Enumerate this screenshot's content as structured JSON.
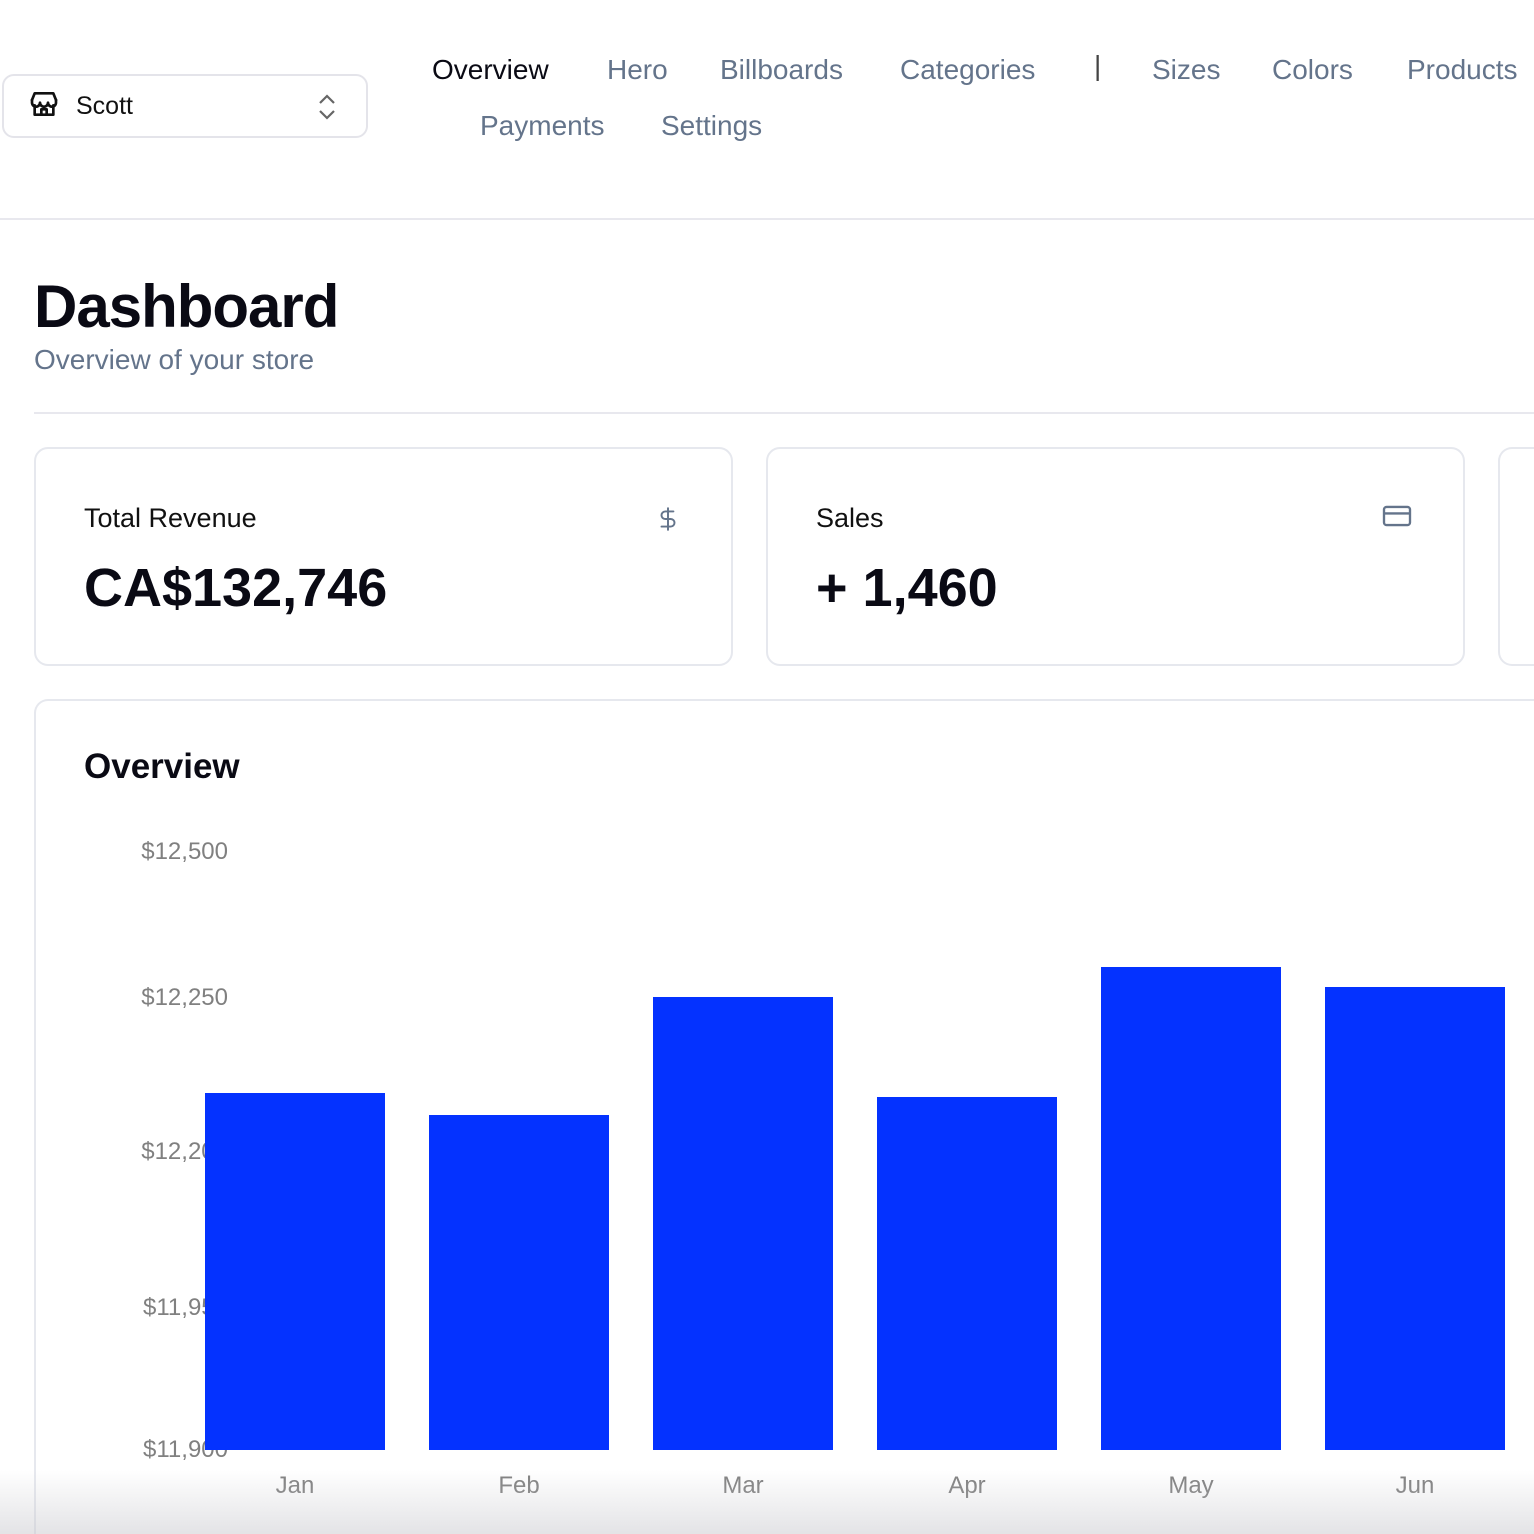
{
  "store_switcher": {
    "name": "Scott",
    "icon": "store-icon",
    "chevron": "chevrons-up-down-icon"
  },
  "nav": {
    "items": [
      "Overview",
      "Hero",
      "Billboards",
      "Categories",
      "|",
      "Sizes",
      "Colors",
      "Products",
      "Payments",
      "Settings"
    ],
    "active": "Overview"
  },
  "header": {
    "title": "Dashboard",
    "subtitle": "Overview of your store"
  },
  "cards": [
    {
      "label": "Total Revenue",
      "value": "CA$132,746",
      "icon": "dollar-sign-icon"
    },
    {
      "label": "Sales",
      "value": "+ 1,460",
      "icon": "credit-card-icon"
    }
  ],
  "chart_data": {
    "type": "bar",
    "title": "Overview",
    "categories": [
      "Jan",
      "Feb",
      "Mar",
      "Apr",
      "May",
      "Jun"
    ],
    "values": [
      12219,
      12212,
      12251,
      12218,
      12303,
      12269
    ],
    "y_tick_labels": [
      "$12,500",
      "$12,250",
      "$12,200",
      "$11,950",
      "$11,900"
    ],
    "y_tick_values": [
      12500,
      12250,
      12200,
      11950,
      11900
    ],
    "bar_color": "#0432ff",
    "grid": false
  }
}
